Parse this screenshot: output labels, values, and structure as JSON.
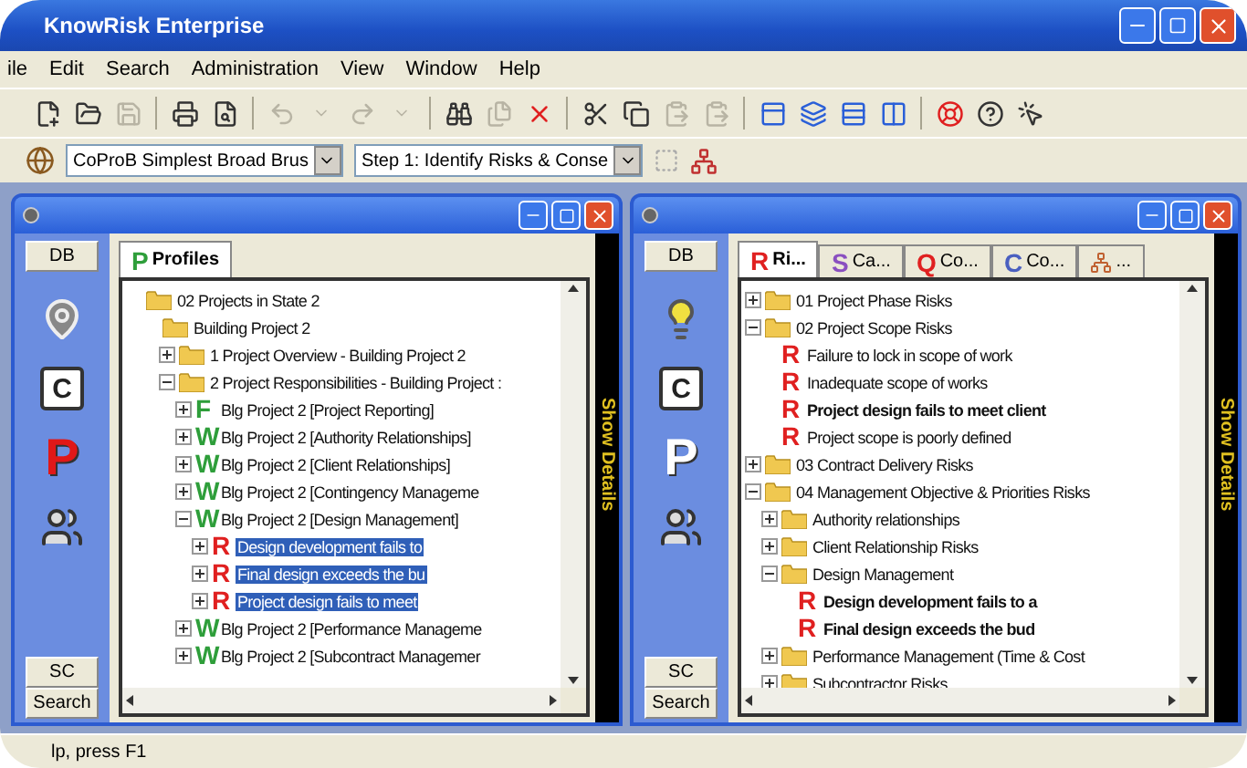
{
  "window": {
    "title": "KnowRisk Enterprise"
  },
  "menu": [
    "ile",
    "Edit",
    "Search",
    "Administration",
    "View",
    "Window",
    "Help"
  ],
  "toolbar": [
    {
      "kind": "new",
      "disabled": false
    },
    {
      "kind": "open",
      "disabled": false
    },
    {
      "kind": "save",
      "disabled": true
    },
    {
      "kind": "separator"
    },
    {
      "kind": "print",
      "disabled": false
    },
    {
      "kind": "preview",
      "disabled": false
    },
    {
      "kind": "separator"
    },
    {
      "kind": "undo",
      "disabled": true
    },
    {
      "kind": "drop",
      "disabled": true
    },
    {
      "kind": "redo",
      "disabled": true
    },
    {
      "kind": "drop",
      "disabled": true
    },
    {
      "kind": "separator"
    },
    {
      "kind": "find",
      "disabled": false
    },
    {
      "kind": "files",
      "disabled": true
    },
    {
      "kind": "delete",
      "disabled": false
    },
    {
      "kind": "separator"
    },
    {
      "kind": "cut",
      "disabled": false
    },
    {
      "kind": "copy",
      "disabled": false
    },
    {
      "kind": "paste",
      "disabled": true
    },
    {
      "kind": "paste",
      "disabled": true
    },
    {
      "kind": "separator"
    },
    {
      "kind": "cascade",
      "disabled": false
    },
    {
      "kind": "layers",
      "disabled": false
    },
    {
      "kind": "rows",
      "disabled": false
    },
    {
      "kind": "columns",
      "disabled": false
    },
    {
      "kind": "separator"
    },
    {
      "kind": "lifebuoy",
      "disabled": false
    },
    {
      "kind": "help",
      "disabled": false
    },
    {
      "kind": "pointer",
      "disabled": false
    }
  ],
  "selectors": [
    {
      "value": "CoProB Simplest Broad Brus"
    },
    {
      "value": "Step 1: Identify Risks & Conse"
    }
  ],
  "panels": [
    {
      "sidebar_top": "DB",
      "sidebar_icons": [
        {
          "kind": "pin"
        },
        {
          "kind": "letter",
          "text": "C"
        },
        {
          "kind": "flag",
          "text": "P",
          "selected": true
        },
        {
          "kind": "people"
        }
      ],
      "sidebar_bottom": [
        "SC",
        "Search"
      ],
      "tabs": [
        {
          "mark": "P",
          "color": "#2e9e3a",
          "label": "Profiles",
          "selected": true
        }
      ],
      "side_strip": "Show Details",
      "tree": [
        {
          "kind": "folder",
          "label": "02 Projects in State 2",
          "selected": false,
          "children": [
            {
              "kind": "folder",
              "label": "Building Project 2",
              "selected": false,
              "children": [
                {
                  "kind": "folder",
                  "label": "1 Project Overview - Building Project 2",
                  "expanded": false,
                  "selected": false
                },
                {
                  "kind": "folder",
                  "label": "2 Project Responsibilities - Building Project :",
                  "expanded": true,
                  "selected": false,
                  "children": [
                    {
                      "kind": "letter",
                      "mark": "F",
                      "color": "#2e9e3a",
                      "label": "Blg Project 2 [Project Reporting]",
                      "expanded": false,
                      "selected": false
                    },
                    {
                      "kind": "letter",
                      "mark": "W",
                      "color": "#2e9e3a",
                      "label": "Blg Project 2 [Authority Relationships]",
                      "expanded": false,
                      "selected": false
                    },
                    {
                      "kind": "letter",
                      "mark": "W",
                      "color": "#2e9e3a",
                      "label": "Blg Project 2 [Client Relationships]",
                      "expanded": false,
                      "selected": false
                    },
                    {
                      "kind": "letter",
                      "mark": "W",
                      "color": "#2e9e3a",
                      "label": "Blg Project 2 [Contingency Manageme",
                      "expanded": false,
                      "selected": false
                    },
                    {
                      "kind": "letter",
                      "mark": "W",
                      "color": "#2e9e3a",
                      "label": "Blg Project 2 [Design Management]",
                      "expanded": true,
                      "selected": false,
                      "children": [
                        {
                          "kind": "letter",
                          "mark": "R",
                          "color": "#e02020",
                          "label": "Design development fails to",
                          "expanded": false,
                          "selected": true
                        },
                        {
                          "kind": "letter",
                          "mark": "R",
                          "color": "#e02020",
                          "label": "Final design exceeds the bu",
                          "expanded": false,
                          "selected": true
                        },
                        {
                          "kind": "letter",
                          "mark": "R",
                          "color": "#e02020",
                          "label": "Project design fails to meet",
                          "expanded": false,
                          "selected": true
                        }
                      ]
                    },
                    {
                      "kind": "letter",
                      "mark": "W",
                      "color": "#2e9e3a",
                      "label": "Blg Project 2 [Performance Manageme",
                      "expanded": false,
                      "selected": false
                    },
                    {
                      "kind": "letter",
                      "mark": "W",
                      "color": "#2e9e3a",
                      "label": "Blg Project 2 [Subcontract Managemer",
                      "expanded": false,
                      "selected": false
                    }
                  ]
                }
              ]
            }
          ]
        }
      ]
    },
    {
      "sidebar_top": "DB",
      "sidebar_icons": [
        {
          "kind": "bulb"
        },
        {
          "kind": "letter",
          "text": "C"
        },
        {
          "kind": "flag",
          "text": "P",
          "selected": false
        },
        {
          "kind": "people"
        }
      ],
      "sidebar_bottom": [
        "SC",
        "Search"
      ],
      "tabs": [
        {
          "mark": "R",
          "color": "#e02020",
          "label": "Ri...",
          "selected": true
        },
        {
          "mark": "S",
          "color": "#8a4fc0",
          "label": "Ca...",
          "selected": false
        },
        {
          "mark": "Q",
          "color": "#e02020",
          "label": "Co...",
          "selected": false
        },
        {
          "mark": "C",
          "color": "#4a5fc0",
          "label": "Co...",
          "selected": false
        },
        {
          "label": "...",
          "selected": false
        }
      ],
      "side_strip": "Show Details",
      "tree": [
        {
          "kind": "folder",
          "label": "01 Project Phase Risks",
          "expanded": false,
          "selected": false
        },
        {
          "kind": "folder",
          "label": "02 Project Scope Risks",
          "expanded": true,
          "selected": false,
          "children": [
            {
              "kind": "letter",
              "mark": "R",
              "color": "#e02020",
              "label": "Failure to lock in scope of work",
              "bold": false,
              "selected": false
            },
            {
              "kind": "letter",
              "mark": "R",
              "color": "#e02020",
              "label": "Inadequate scope of works",
              "bold": false,
              "selected": false
            },
            {
              "kind": "letter",
              "mark": "R",
              "color": "#e02020",
              "label": "Project design fails to meet client",
              "bold": true,
              "selected": false
            },
            {
              "kind": "letter",
              "mark": "R",
              "color": "#e02020",
              "label": "Project scope is poorly defined",
              "bold": false,
              "selected": false
            }
          ]
        },
        {
          "kind": "folder",
          "label": "03 Contract Delivery Risks",
          "expanded": false,
          "selected": false
        },
        {
          "kind": "folder",
          "label": "04 Management Objective & Priorities Risks",
          "expanded": true,
          "selected": false,
          "children": [
            {
              "kind": "folder",
              "label": "Authority relationships",
              "expanded": false,
              "selected": false
            },
            {
              "kind": "folder",
              "label": "Client Relationship Risks",
              "expanded": false,
              "selected": false
            },
            {
              "kind": "folder",
              "label": "Design Management",
              "expanded": true,
              "selected": false,
              "children": [
                {
                  "kind": "letter",
                  "mark": "R",
                  "color": "#e02020",
                  "label": "Design development fails to a",
                  "bold": true,
                  "selected": false
                },
                {
                  "kind": "letter",
                  "mark": "R",
                  "color": "#e02020",
                  "label": "Final design exceeds the bud",
                  "bold": true,
                  "selected": false
                }
              ]
            },
            {
              "kind": "folder",
              "label": "Performance Management (Time & Cost",
              "expanded": false,
              "selected": false
            },
            {
              "kind": "folder",
              "label": "Subcontractor Risks",
              "expanded": false,
              "selected": false
            }
          ]
        }
      ]
    }
  ],
  "status_bar": {
    "text": "lp, press F1"
  }
}
